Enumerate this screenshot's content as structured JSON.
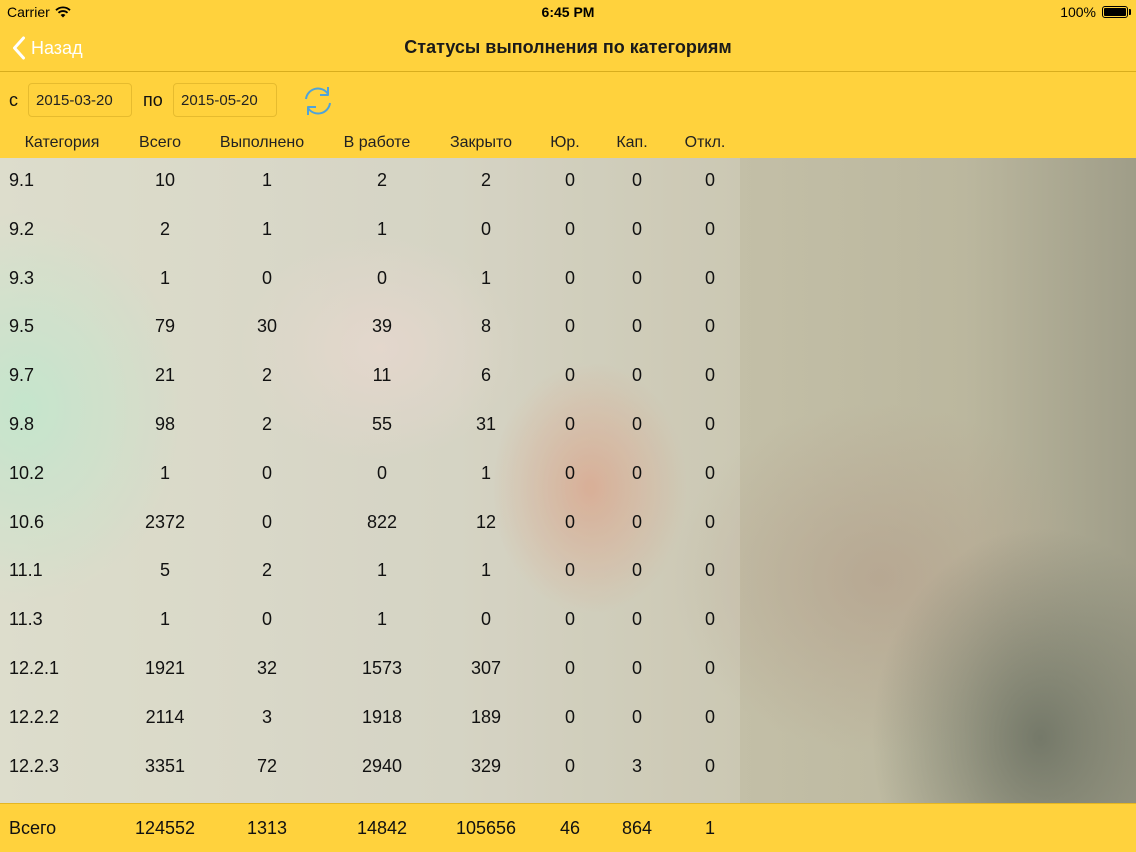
{
  "status_bar": {
    "carrier": "Carrier",
    "time": "6:45 PM",
    "battery": "100%",
    "icons": [
      "wifi-icon",
      "battery-icon"
    ]
  },
  "nav": {
    "back_label": "Назад",
    "title": "Статусы выполнения по категориям",
    "back_icon": "chevron-left-icon"
  },
  "filter": {
    "from_label": "с",
    "from_value": "2015-03-20",
    "to_label": "по",
    "to_value": "2015-05-20",
    "refresh_icon": "refresh-icon",
    "accent_color": "#4fa3d9"
  },
  "table": {
    "columns": [
      "Категория",
      "Всего",
      "Выполнено",
      "В работе",
      "Закрыто",
      "Юр.",
      "Кап.",
      "Откл."
    ],
    "rows": [
      [
        "9.1",
        "10",
        "1",
        "2",
        "2",
        "0",
        "0",
        "0"
      ],
      [
        "9.2",
        "2",
        "1",
        "1",
        "0",
        "0",
        "0",
        "0"
      ],
      [
        "9.3",
        "1",
        "0",
        "0",
        "1",
        "0",
        "0",
        "0"
      ],
      [
        "9.5",
        "79",
        "30",
        "39",
        "8",
        "0",
        "0",
        "0"
      ],
      [
        "9.7",
        "21",
        "2",
        "11",
        "6",
        "0",
        "0",
        "0"
      ],
      [
        "9.8",
        "98",
        "2",
        "55",
        "31",
        "0",
        "0",
        "0"
      ],
      [
        "10.2",
        "1",
        "0",
        "0",
        "1",
        "0",
        "0",
        "0"
      ],
      [
        "10.6",
        "2372",
        "0",
        "822",
        "12",
        "0",
        "0",
        "0"
      ],
      [
        "11.1",
        "5",
        "2",
        "1",
        "1",
        "0",
        "0",
        "0"
      ],
      [
        "11.3",
        "1",
        "0",
        "1",
        "0",
        "0",
        "0",
        "0"
      ],
      [
        "12.2.1",
        "1921",
        "32",
        "1573",
        "307",
        "0",
        "0",
        "0"
      ],
      [
        "12.2.2",
        "2114",
        "3",
        "1918",
        "189",
        "0",
        "0",
        "0"
      ],
      [
        "12.2.3",
        "3351",
        "72",
        "2940",
        "329",
        "0",
        "3",
        "0"
      ]
    ],
    "totals": [
      "Всего",
      "124552",
      "1313",
      "14842",
      "105656",
      "46",
      "864",
      "1"
    ]
  },
  "colors": {
    "header_bg": "#ffd23d",
    "back_text": "#ffffff"
  }
}
